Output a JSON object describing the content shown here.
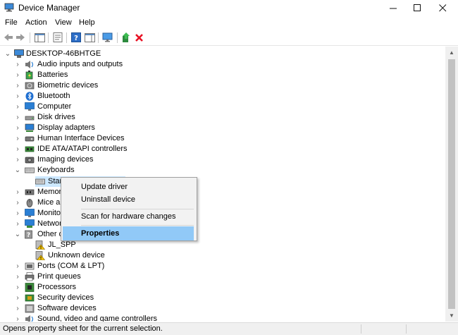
{
  "window": {
    "title": "Device Manager"
  },
  "menu": {
    "file": "File",
    "action": "Action",
    "view": "View",
    "help": "Help"
  },
  "tree": {
    "root": "DESKTOP-46BHTGE",
    "items": [
      "Audio inputs and outputs",
      "Batteries",
      "Biometric devices",
      "Bluetooth",
      "Computer",
      "Disk drives",
      "Display adapters",
      "Human Interface Devices",
      "IDE ATA/ATAPI controllers",
      "Imaging devices",
      "Keyboards",
      "Stan",
      "Memor",
      "Mice ar",
      "Monito",
      "Networ",
      "Other d",
      "JL_SPP",
      "Unknown device",
      "Ports (COM & LPT)",
      "Print queues",
      "Processors",
      "Security devices",
      "Software devices",
      "Sound, video and game controllers"
    ]
  },
  "context_menu": {
    "update_driver": "Update driver",
    "uninstall_device": "Uninstall device",
    "scan": "Scan for hardware changes",
    "properties": "Properties"
  },
  "status": {
    "text": "Opens property sheet for the current selection."
  },
  "colors": {
    "highlight": "#91c9f7",
    "selection": "#cce8ff",
    "delete": "#e81123",
    "monitor": "#2a7fd4"
  }
}
